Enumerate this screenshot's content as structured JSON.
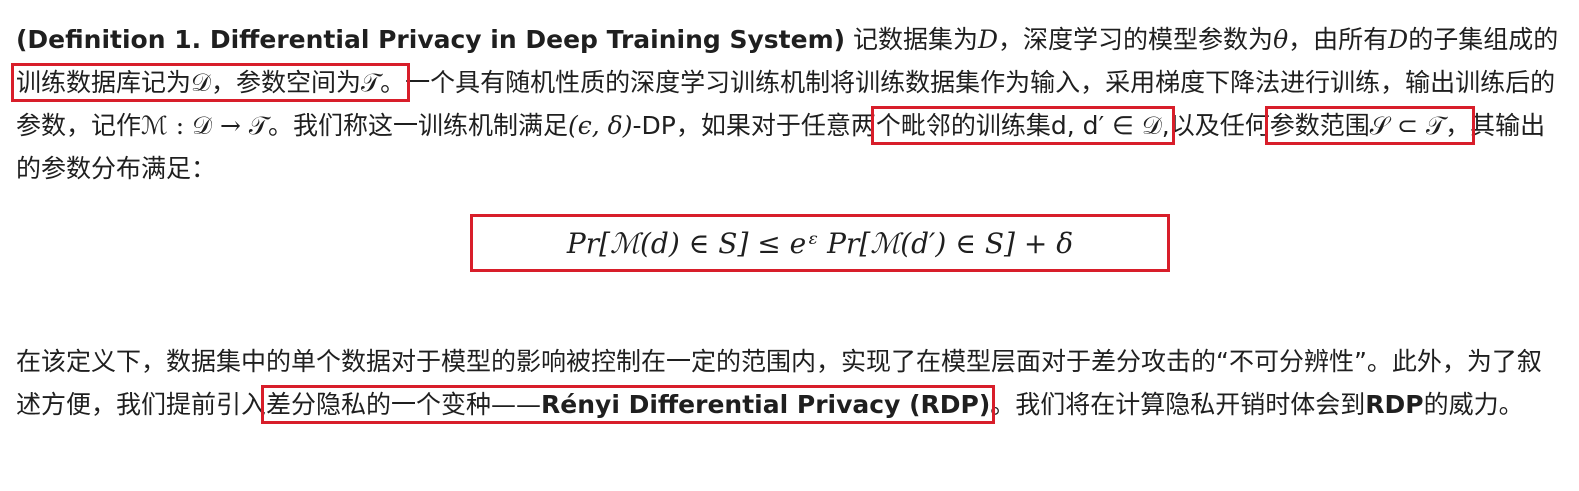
{
  "paragraph1": {
    "definition_title": "(Definition 1. Differential Privacy in Deep Training System)",
    "t1": " 记数据集为",
    "sym_D": "D",
    "t2": "，深度学习的模型参数为",
    "sym_theta": "θ",
    "t3": "，由所有",
    "sym_D2": "D",
    "t4": "的子集组成的",
    "box1": "训练数据库记为𝒟，参数空间为𝒯。",
    "t5": "一个具有随机性质的深度学习训练机制将训练数据集作为输入，采用梯度下降法进行训练，输出训练后的参数，记作",
    "mech": "ℳ : 𝒟 → 𝒯",
    "t6": "。我们称这一训练机制满足",
    "eps_delta": "(ϵ, δ)",
    "t7": "-DP，如果对于任意两",
    "box2": "个毗邻的训练集d, d′ ∈ 𝒟,",
    "t8": "以及任何",
    "box3": "参数范围𝒮 ⊂ 𝒯，",
    "t9": "其输出的参数分布满足："
  },
  "formula": "Pr[ℳ(d) ∈ S] ≤ eᵋ Pr[ℳ(d′) ∈ S] + δ",
  "paragraph2": {
    "t1": "在该定义下，数据集中的单个数据对于模型的影响被控制在一定的范围内，实现了在模型层面对于差分攻击的“不可分辨性”。此外，为了叙述方便，我们提前引入",
    "box4_plain": "差分隐私的一个变种——",
    "box4_bold": "Rényi Differential Privacy (RDP)",
    "t2": "。我们将在计算隐私开销时体会到",
    "rdp_bold": "RDP",
    "t3": "的威力。"
  },
  "colors": {
    "highlight_box": "#d81e2a",
    "text": "#1f1f1f"
  }
}
